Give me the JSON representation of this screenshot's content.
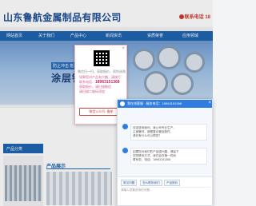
{
  "header": {
    "company_title": "山东鲁航金属制品有限公司",
    "hotline_label": "联系电话 18"
  },
  "nav": {
    "items": [
      "网站首页",
      "关于我们",
      "产品中心",
      "新闻资讯",
      "资质荣誉",
      "应用领域"
    ]
  },
  "banner": {
    "tag": "防止冲击 抵抗腐蚀",
    "headline": "涂层钦氧管"
  },
  "products": {
    "category_head": "产品分类",
    "section_head": "产品展示"
  },
  "qr_popup": {
    "close": "×",
    "caption": "微信扫一扫，获取报价，帮你选购",
    "line1": "如果您对产品有兴趣，请拨打：",
    "phone_label": "联系电话：",
    "phone": "18963151368",
    "line3": "获取报价，请扫描微信",
    "line4": "请扫描二维码添加",
    "button": "微信公众号: 鲁航"
  },
  "chat": {
    "title": "我在线客服 · 服务电话：18963151368",
    "close": "×",
    "msg1": [
      "欢迎咨询我司，我公司专业生产，",
      "主营管材、钢塑复合管及配件，",
      "请问有什么可以帮您？"
    ],
    "msg2": [
      "如果您对我们的产品感兴趣，请留下",
      "您的联系方式，我们会在第一时间",
      "联系您，电话：18963151368"
    ],
    "quick1": "常见问题",
    "quick2": "怎么联系我们",
    "quick3": "产品报价",
    "input_placeholder": "请输入您要咨询的问题..."
  }
}
